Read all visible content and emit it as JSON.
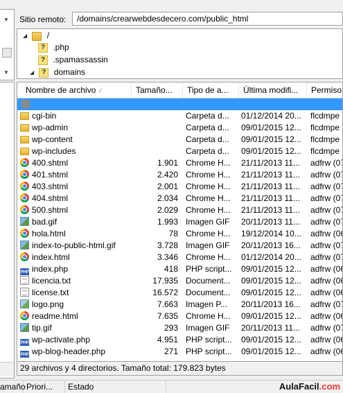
{
  "remote": {
    "label": "Sitio remoto:",
    "path": "/domains/crearwebdesdecero.com/public_html"
  },
  "tree": [
    {
      "name": "/",
      "icon": "folder-icon",
      "expanded": true
    },
    {
      "name": ".php",
      "icon": "unknown-icon"
    },
    {
      "name": ".spamassassin",
      "icon": "unknown-icon"
    },
    {
      "name": "domains",
      "icon": "unknown-icon",
      "expanded": true
    }
  ],
  "columns": {
    "name": "Nombre de archivo",
    "size": "Tamaño...",
    "type": "Tipo de a...",
    "modified": "Última modifi...",
    "perms": "Permiso"
  },
  "files": [
    {
      "name": "cgi-bin",
      "size": "",
      "type": "Carpeta d...",
      "modified": "01/12/2014 20...",
      "perms": "flcdmpe",
      "icon": "folder"
    },
    {
      "name": "wp-admin",
      "size": "",
      "type": "Carpeta d...",
      "modified": "09/01/2015 12...",
      "perms": "flcdmpe",
      "icon": "folder"
    },
    {
      "name": "wp-content",
      "size": "",
      "type": "Carpeta d...",
      "modified": "09/01/2015 12...",
      "perms": "flcdmpe",
      "icon": "folder"
    },
    {
      "name": "wp-includes",
      "size": "",
      "type": "Carpeta d...",
      "modified": "09/01/2015 12...",
      "perms": "flcdmpe",
      "icon": "folder"
    },
    {
      "name": "400.shtml",
      "size": "1.901",
      "type": "Chrome H...",
      "modified": "21/11/2013 11...",
      "perms": "adfrw (07",
      "icon": "chrome"
    },
    {
      "name": "401.shtml",
      "size": "2.420",
      "type": "Chrome H...",
      "modified": "21/11/2013 11...",
      "perms": "adfrw (07",
      "icon": "chrome"
    },
    {
      "name": "403.shtml",
      "size": "2.001",
      "type": "Chrome H...",
      "modified": "21/11/2013 11...",
      "perms": "adfrw (07",
      "icon": "chrome"
    },
    {
      "name": "404.shtml",
      "size": "2.034",
      "type": "Chrome H...",
      "modified": "21/11/2013 11...",
      "perms": "adfrw (07",
      "icon": "chrome"
    },
    {
      "name": "500.shtml",
      "size": "2.029",
      "type": "Chrome H...",
      "modified": "21/11/2013 11...",
      "perms": "adfrw (07",
      "icon": "chrome"
    },
    {
      "name": "bad.gif",
      "size": "1.993",
      "type": "Imagen GIF",
      "modified": "20/11/2013 11...",
      "perms": "adfrw (07",
      "icon": "gif"
    },
    {
      "name": "hola.html",
      "size": "78",
      "type": "Chrome H...",
      "modified": "19/12/2014 10...",
      "perms": "adfrw (06",
      "icon": "chrome"
    },
    {
      "name": "index-to-public-html.gif",
      "size": "3.728",
      "type": "Imagen GIF",
      "modified": "20/11/2013 16...",
      "perms": "adfrw (07",
      "icon": "gif"
    },
    {
      "name": "index.html",
      "size": "3.346",
      "type": "Chrome H...",
      "modified": "01/12/2014 20...",
      "perms": "adfrw (07",
      "icon": "chrome"
    },
    {
      "name": "index.php",
      "size": "418",
      "type": "PHP script...",
      "modified": "09/01/2015 12...",
      "perms": "adfrw (06",
      "icon": "php"
    },
    {
      "name": "licencia.txt",
      "size": "17.935",
      "type": "Document...",
      "modified": "09/01/2015 12...",
      "perms": "adfrw (06",
      "icon": "txt"
    },
    {
      "name": "license.txt",
      "size": "16.572",
      "type": "Document...",
      "modified": "09/01/2015 12...",
      "perms": "adfrw (06",
      "icon": "txt"
    },
    {
      "name": "logo.png",
      "size": "7.663",
      "type": "Imagen P...",
      "modified": "20/11/2013 16...",
      "perms": "adfrw (07",
      "icon": "png"
    },
    {
      "name": "readme.html",
      "size": "7.635",
      "type": "Chrome H...",
      "modified": "09/01/2015 12...",
      "perms": "adfrw (06",
      "icon": "chrome"
    },
    {
      "name": "tip.gif",
      "size": "293",
      "type": "Imagen GIF",
      "modified": "20/11/2013 11...",
      "perms": "adfrw (07",
      "icon": "gif"
    },
    {
      "name": "wp-activate.php",
      "size": "4.951",
      "type": "PHP script...",
      "modified": "09/01/2015 12...",
      "perms": "adfrw (06",
      "icon": "php"
    },
    {
      "name": "wp-blog-header.php",
      "size": "271",
      "type": "PHP script...",
      "modified": "09/01/2015 12...",
      "perms": "adfrw (06",
      "icon": "php"
    }
  ],
  "status": "29 archivos y 4 directorios. Tamaño total: 179.823 bytes",
  "queue": {
    "col_size": "amaño",
    "col_priority": "Priori...",
    "col_status": "Estado"
  },
  "brand": {
    "name": "AulaFacil",
    "suffix": ".com",
    "accent": "#e53935"
  },
  "colors": {
    "selection": "#3399ff"
  }
}
